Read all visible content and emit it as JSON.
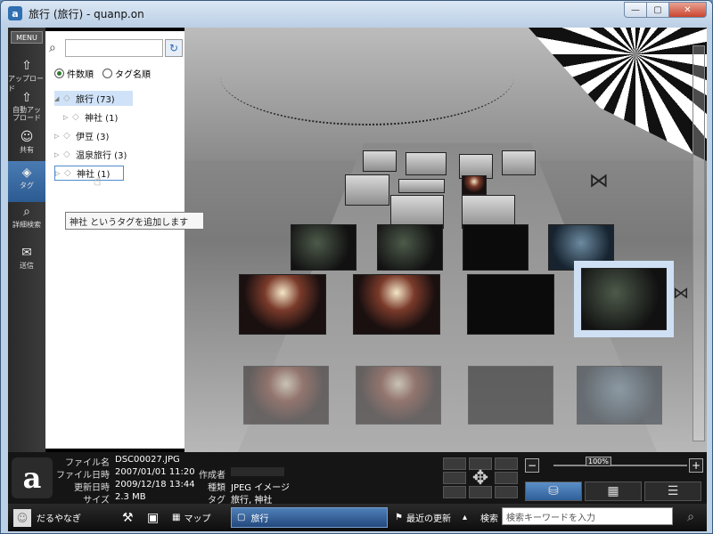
{
  "window": {
    "title": "旅行 (旅行) - quanp.on",
    "app_icon": "quanp-logo-icon",
    "minimize": "—",
    "maximize": "▢",
    "close": "✕"
  },
  "rail": {
    "menu_label": "MENU",
    "items": [
      {
        "label": "アップロード",
        "icon": "upload-icon",
        "glyph": "⇧"
      },
      {
        "label": "自動アップロード",
        "icon": "auto-upload-icon",
        "glyph": "⇧"
      },
      {
        "label": "共有",
        "icon": "share-icon",
        "glyph": "☺"
      },
      {
        "label": "タグ",
        "icon": "tag-icon",
        "glyph": "◈"
      },
      {
        "label": "詳細検索",
        "icon": "magnifier-icon",
        "glyph": "⌕"
      },
      {
        "label": "送信",
        "icon": "envelope-icon",
        "glyph": "✉"
      }
    ]
  },
  "panel": {
    "search_placeholder": "",
    "sort_count_label": "件数順",
    "sort_name_label": "タグ名順",
    "tree": [
      {
        "label": "旅行 (73)",
        "level": 0,
        "expanded": true,
        "selected": true
      },
      {
        "label": "神社 (1)",
        "level": 1
      },
      {
        "label": "伊豆 (3)",
        "level": 0
      },
      {
        "label": "温泉旅行 (3)",
        "level": 0
      },
      {
        "label": "神社 (1)",
        "level": 0,
        "hover": true
      }
    ],
    "tooltip": "神社 というタグを追加します"
  },
  "info": {
    "filename_label": "ファイル名",
    "filename": "DSC00027.JPG",
    "filedate_label": "ファイル日時",
    "filedate": "2007/01/01 11:20",
    "author_label": "作成者",
    "updated_label": "更新日時",
    "updated": "2009/12/18 13:44",
    "kind_label": "種類",
    "kind": "JPEG イメージ",
    "size_label": "サイズ",
    "size": "2.3 MB",
    "tags_label": "タグ",
    "tags": "旅行, 神社"
  },
  "zoom": {
    "label": "100%",
    "minus": "−",
    "plus": "+"
  },
  "taskbar": {
    "user_name": "だるやなぎ",
    "map_label": "マップ",
    "active_tab": "旅行",
    "recent_label": "最近の更新",
    "search_label": "検索",
    "search_placeholder": "検索キーワードを入力"
  },
  "colors": {
    "accent": "#2f5f98",
    "selected_tag": "#cfe2f8"
  }
}
